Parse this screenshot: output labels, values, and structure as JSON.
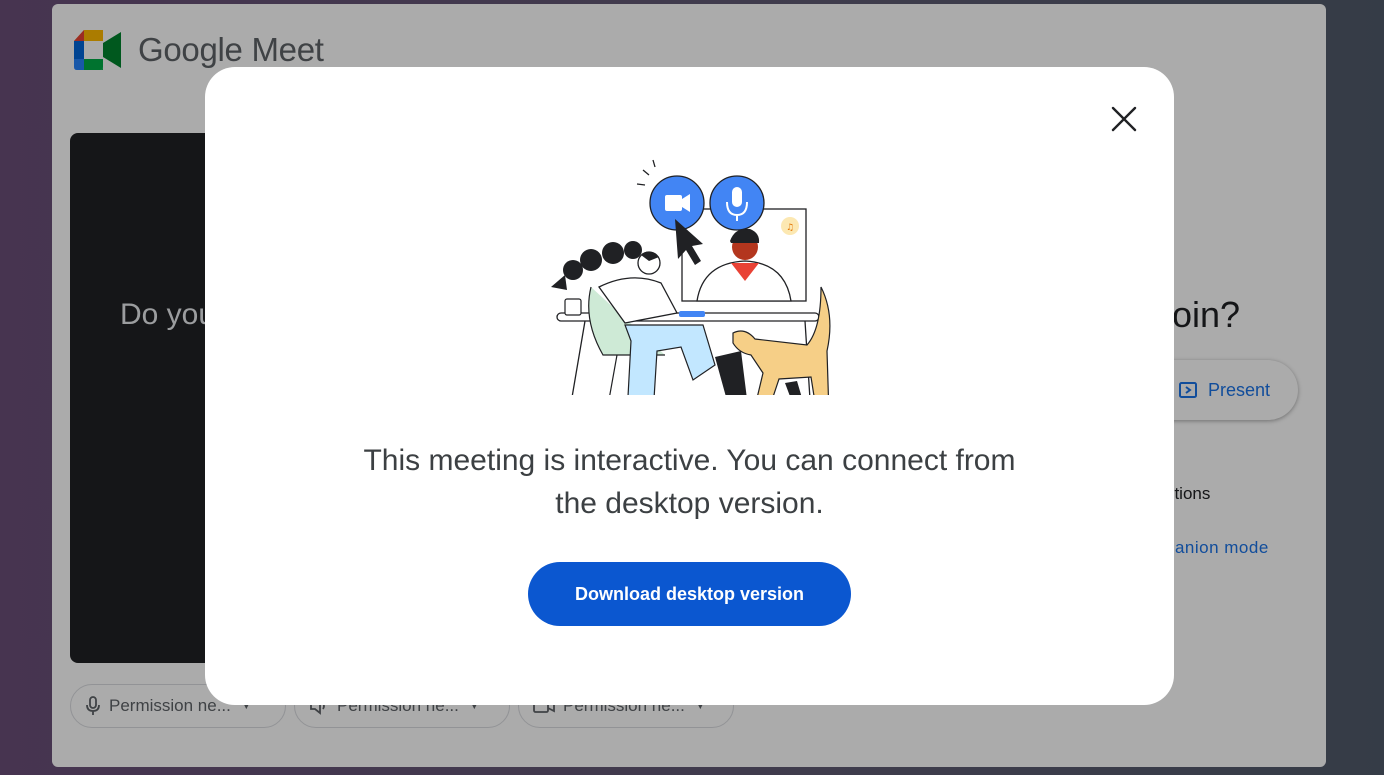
{
  "app": {
    "brand_name": "Google Meet"
  },
  "preview": {
    "text": "Do you"
  },
  "side_panel": {
    "join_question": "join?",
    "present_label": "Present",
    "other_options": "ptions",
    "companion_mode": "panion mode"
  },
  "permissions": [
    {
      "label": "Permission ne...",
      "icon": "microphone-icon"
    },
    {
      "label": "Permission ne...",
      "icon": "speaker-icon"
    },
    {
      "label": "Permission ne...",
      "icon": "camera-icon"
    }
  ],
  "dialog": {
    "message_line1": "This meeting is interactive. You can connect from",
    "message_line2": "the desktop version.",
    "download_button": "Download desktop version",
    "close_icon": "close-icon"
  },
  "colors": {
    "primary_button": "#0b57d0",
    "link": "#1a73e8",
    "meet_green": "#00832d",
    "meet_blue": "#0066da",
    "meet_yellow": "#ffba00",
    "meet_red": "#e94235"
  }
}
